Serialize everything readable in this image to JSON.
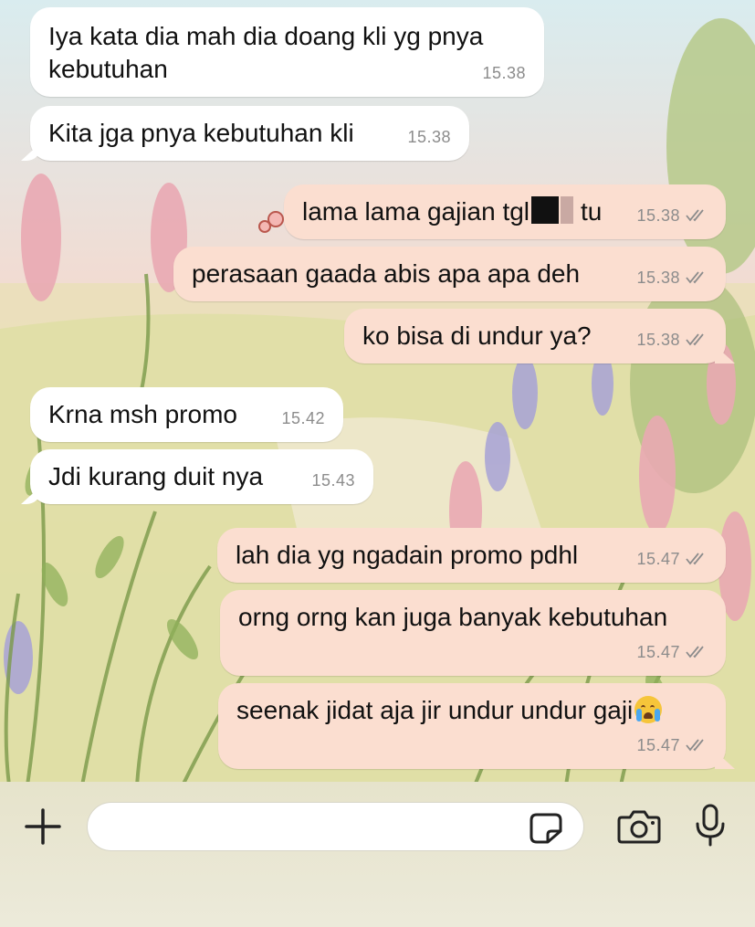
{
  "colors": {
    "incoming_bubble": "#ffffff",
    "outgoing_bubble": "#fbded0",
    "timestamp": "#8c8c8c",
    "input_bar": "#e8e6d0"
  },
  "messages": [
    {
      "direction": "incoming",
      "lines": [
        "Iya kata dia mah dia doang kli yg pnya",
        "kebutuhan"
      ],
      "time": "15.38"
    },
    {
      "direction": "incoming",
      "text": "Kita jga pnya kebutuhan kli",
      "time": "15.38"
    },
    {
      "direction": "outgoing",
      "text_before": "lama lama gajian tgl",
      "text_after": "tu",
      "redacted": true,
      "time": "15.38",
      "status": "read"
    },
    {
      "direction": "outgoing",
      "text": "perasaan gaada abis apa apa deh",
      "time": "15.38",
      "status": "read"
    },
    {
      "direction": "outgoing",
      "text": "ko bisa di undur ya?",
      "time": "15.38",
      "status": "read"
    },
    {
      "direction": "incoming",
      "text": "Krna msh promo",
      "time": "15.42"
    },
    {
      "direction": "incoming",
      "text": "Jdi kurang duit nya",
      "time": "15.43"
    },
    {
      "direction": "outgoing",
      "text": "lah dia yg ngadain promo pdhl",
      "time": "15.47",
      "status": "read"
    },
    {
      "direction": "outgoing",
      "text": "orng orng kan juga banyak kebutuhan",
      "time": "15.47",
      "status": "read"
    },
    {
      "direction": "outgoing",
      "text": "seenak jidat aja jir undur undur gaji",
      "emoji": "loudly-crying-face",
      "time": "15.47",
      "status": "read"
    }
  ],
  "input_bar": {
    "attach_icon": "plus-icon",
    "sticker_icon": "sticker-icon",
    "camera_icon": "camera-icon",
    "mic_icon": "microphone-icon",
    "input_value": ""
  }
}
